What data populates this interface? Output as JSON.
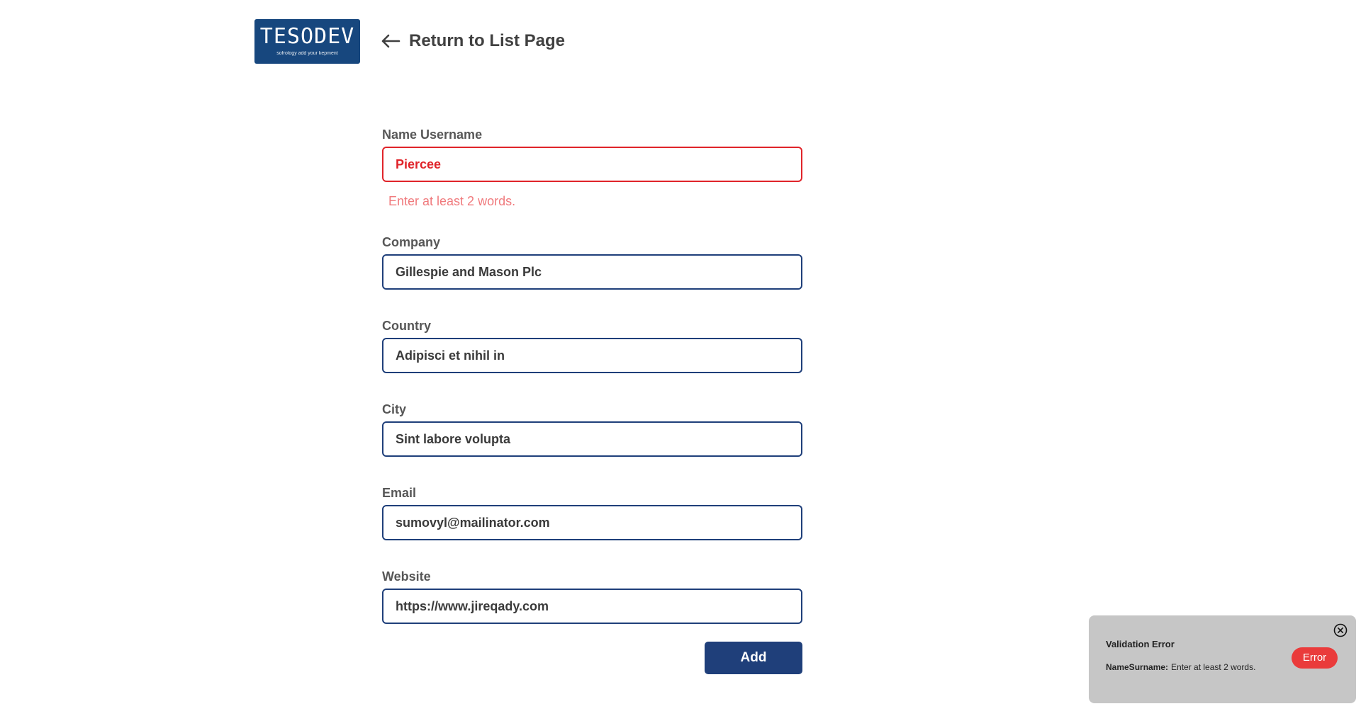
{
  "header": {
    "logo_text": "TESODEV",
    "logo_tagline": "sofrology add your kepment",
    "back_label": "Return to List Page"
  },
  "form": {
    "fields": [
      {
        "label": "Name Username",
        "value": "Piercee",
        "error": "Enter at least 2 words."
      },
      {
        "label": "Company",
        "value": "Gillespie and Mason Plc"
      },
      {
        "label": "Country",
        "value": "Adipisci et nihil in"
      },
      {
        "label": "City",
        "value": "Sint labore volupta"
      },
      {
        "label": "Email",
        "value": "sumovyl@mailinator.com"
      },
      {
        "label": "Website",
        "value": "https://www.jireqady.com"
      }
    ],
    "submit_label": "Add"
  },
  "toast": {
    "title": "Validation Error",
    "field": "NameSurname:",
    "message": "Enter at least 2 words.",
    "badge": "Error"
  },
  "colors": {
    "brand": "#1f3f7a",
    "logo_bg": "#17477e",
    "error": "#e0242a",
    "error_text": "#f07a7d",
    "toast_bg": "#c6c6c6",
    "badge_bg": "#ea3b3b"
  },
  "icons": {
    "back": "arrow-left-icon",
    "toast_close": "close-circle-icon"
  }
}
